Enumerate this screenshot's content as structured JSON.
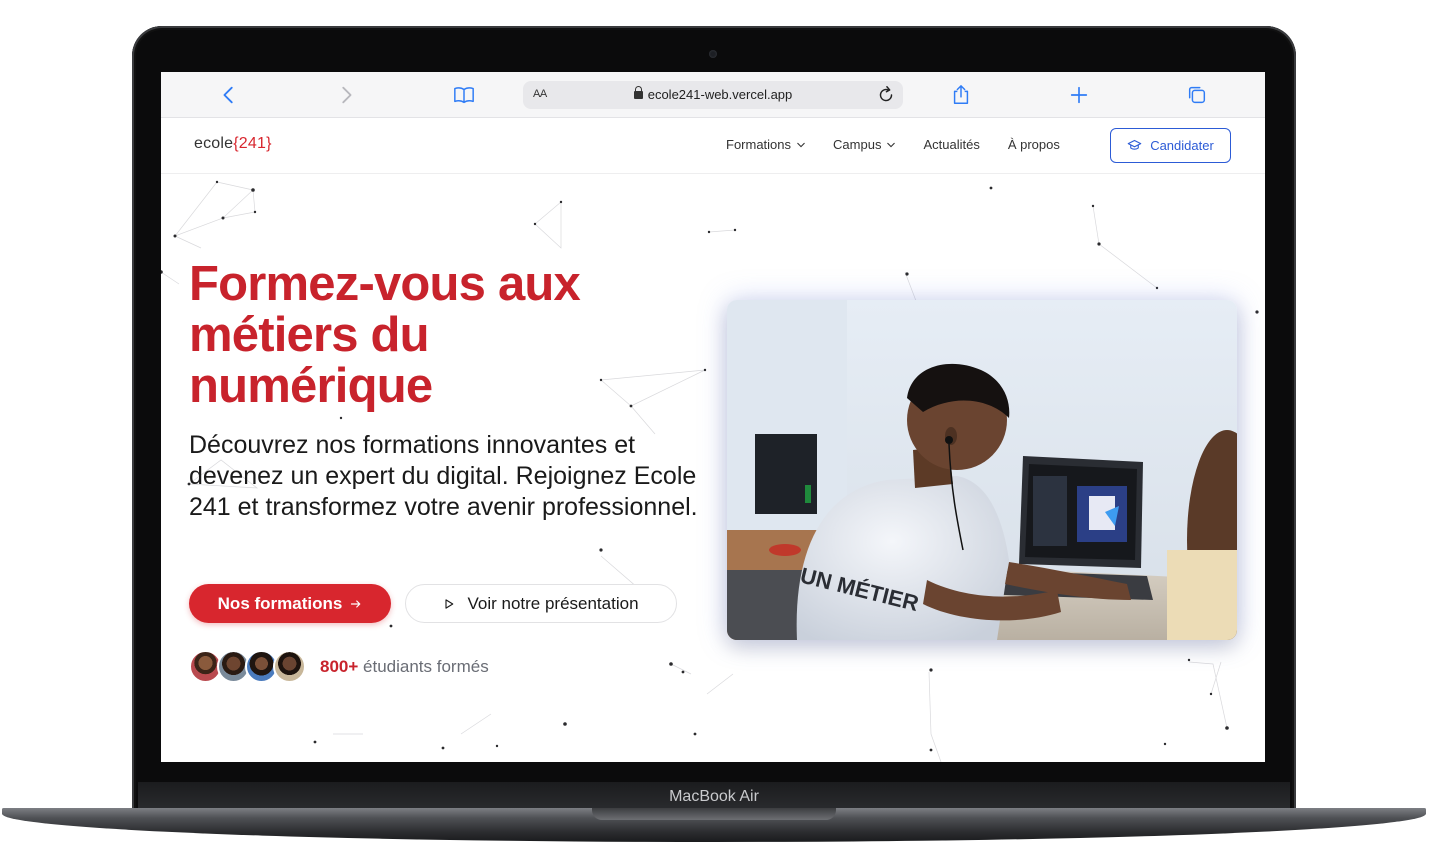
{
  "device": {
    "label": "MacBook Air"
  },
  "browser": {
    "aa_label": "AA",
    "url": "ecole241-web.vercel.app"
  },
  "site": {
    "logo": {
      "word": "ecole",
      "open_brace": "{",
      "number": "241",
      "close_brace": "}"
    },
    "nav": [
      {
        "label": "Formations",
        "has_dropdown": true
      },
      {
        "label": "Campus",
        "has_dropdown": true
      },
      {
        "label": "Actualités",
        "has_dropdown": false
      },
      {
        "label": "À propos",
        "has_dropdown": false
      }
    ],
    "cta_label": "Candidater"
  },
  "hero": {
    "title_lines": [
      "Formez-vous aux",
      "métiers du",
      "numérique"
    ],
    "subtitle": "Découvrez nos formations innovantes et devenez un expert du digital. Rejoignez Ecole 241 et transformez votre avenir professionnel.",
    "primary_button": "Nos formations",
    "secondary_button": "Voir notre présentation",
    "stat_number": "800+",
    "stat_label": "étudiants formés",
    "image_text": "UN MÉTIER"
  },
  "colors": {
    "brand_red": "#c8232c",
    "button_red": "#d8262e",
    "cta_blue": "#2c5bd6",
    "safari_blue": "#2f7cf6"
  }
}
